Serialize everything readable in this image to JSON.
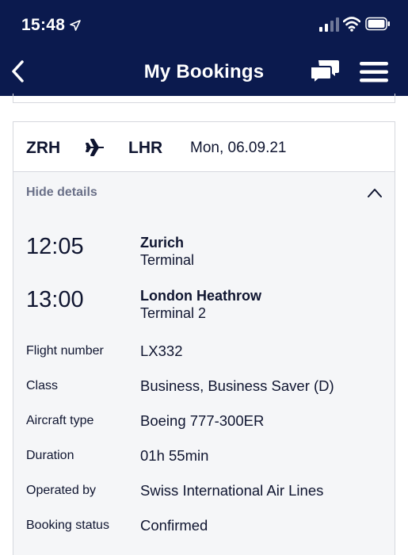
{
  "status_bar": {
    "time": "15:48"
  },
  "header": {
    "title": "My Bookings"
  },
  "flight": {
    "from_code": "ZRH",
    "to_code": "LHR",
    "date": "Mon, 06.09.21",
    "toggle_label": "Hide details",
    "departure": {
      "time": "12:05",
      "airport": "Zurich",
      "terminal": "Terminal"
    },
    "arrival": {
      "time": "13:00",
      "airport": "London Heathrow",
      "terminal": "Terminal 2"
    },
    "info": [
      {
        "label": "Flight number",
        "value": "LX332"
      },
      {
        "label": "Class",
        "value": "Business, Business Saver (D)"
      },
      {
        "label": "Aircraft type",
        "value": "Boeing 777-300ER"
      },
      {
        "label": "Duration",
        "value": "01h 55min"
      },
      {
        "label": "Operated by",
        "value": "Swiss International Air Lines"
      },
      {
        "label": "Booking status",
        "value": "Confirmed"
      }
    ]
  },
  "colors": {
    "header_bg": "#0b1a4e",
    "text": "#0f1530",
    "muted": "#6a7088",
    "details_bg": "#f5f6f8",
    "border": "#d6d8de"
  },
  "icons": {
    "location": "location-arrow-icon",
    "signal": "cellular-signal-icon",
    "wifi": "wifi-icon",
    "battery": "battery-icon",
    "back": "chevron-left-icon",
    "chat": "chat-bubbles-icon",
    "menu": "hamburger-menu-icon",
    "plane": "airplane-icon",
    "collapse": "chevron-up-icon"
  }
}
